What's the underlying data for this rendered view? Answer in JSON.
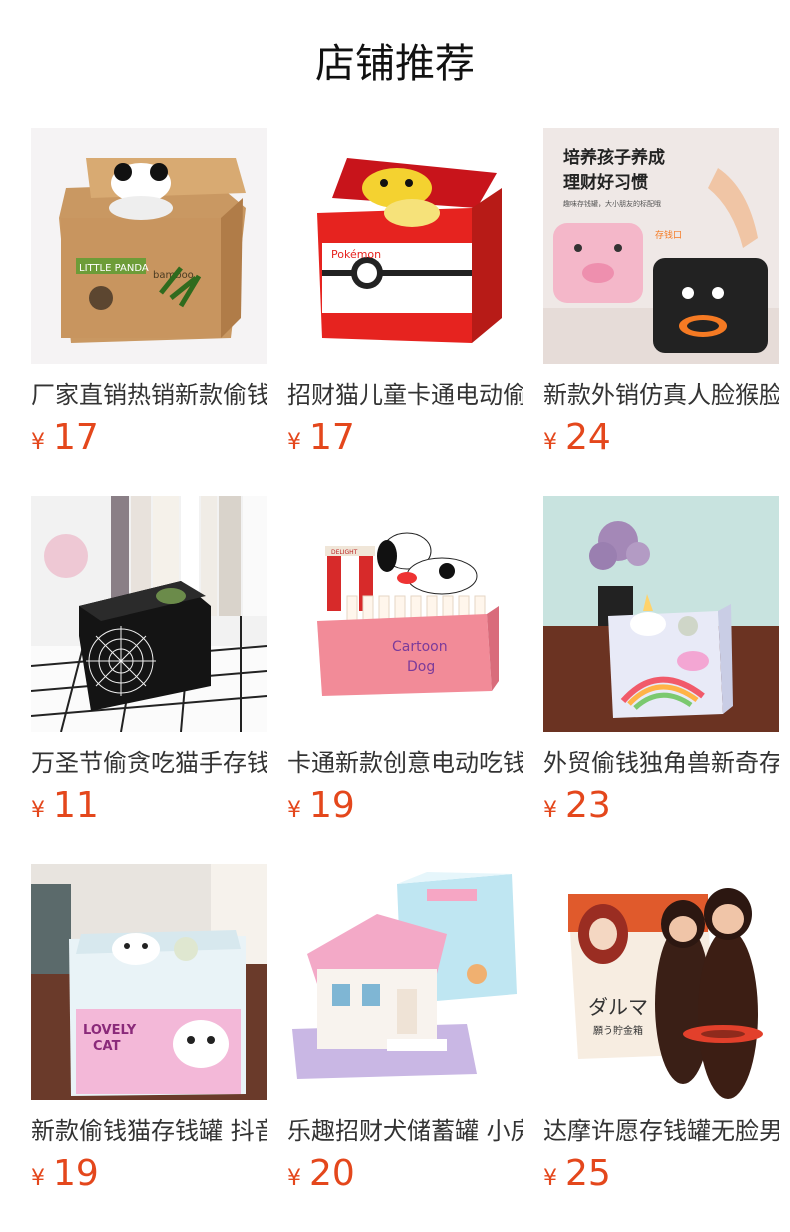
{
  "section_title": "店铺推荐",
  "currency_symbol": "¥",
  "products": [
    {
      "name": "厂家直销热销新款偷钱熊猫存钱罐",
      "price": "17",
      "image_icon": "panda-coin-box-icon"
    },
    {
      "name": "招财猫儿童卡通电动偷钱存钱罐",
      "price": "17",
      "image_icon": "pikachu-coin-box-icon"
    },
    {
      "name": "新款外销仿真人脸猴脸存钱罐",
      "price": "24",
      "image_icon": "pig-face-coin-box-icon"
    },
    {
      "name": "万圣节偷贪吃猫手存钱罐",
      "price": "11",
      "image_icon": "halloween-cat-coin-box-icon"
    },
    {
      "name": "卡通新款创意电动吃钱狗存钱罐",
      "price": "19",
      "image_icon": "cartoon-dog-coin-box-icon"
    },
    {
      "name": "外贸偷钱独角兽新奇存钱罐",
      "price": "23",
      "image_icon": "unicorn-coin-box-icon"
    },
    {
      "name": "新款偷钱猫存钱罐 抖音同款",
      "price": "19",
      "image_icon": "lovely-cat-coin-box-icon"
    },
    {
      "name": "乐趣招财犬储蓄罐 小房子存钱罐",
      "price": "20",
      "image_icon": "dog-house-coin-box-icon"
    },
    {
      "name": "达摩许愿存钱罐无脸男存钱罐",
      "price": "25",
      "image_icon": "daruma-coin-box-icon"
    }
  ],
  "image_text": {
    "p1_line1": "LITTLE PANDA",
    "p1_line2": "bamboo",
    "p2_brand": "Pokémon",
    "p3_line1": "培养孩子养成",
    "p3_line2": "理财好习惯",
    "p3_sub": "趣味存钱罐，大小朋友的标配哦",
    "p3_slot": "存钱口",
    "p5_line1": "Cartoon",
    "p5_line2": "Dog",
    "p5_sign": "DELIGHT",
    "p7_line1": "LOVELY",
    "p7_line2": "CAT",
    "p9_line1": "ダルマ",
    "p9_line2": "願う貯金箱"
  },
  "colors": {
    "price": "#e4471c",
    "title": "#111111",
    "name": "#333333"
  }
}
